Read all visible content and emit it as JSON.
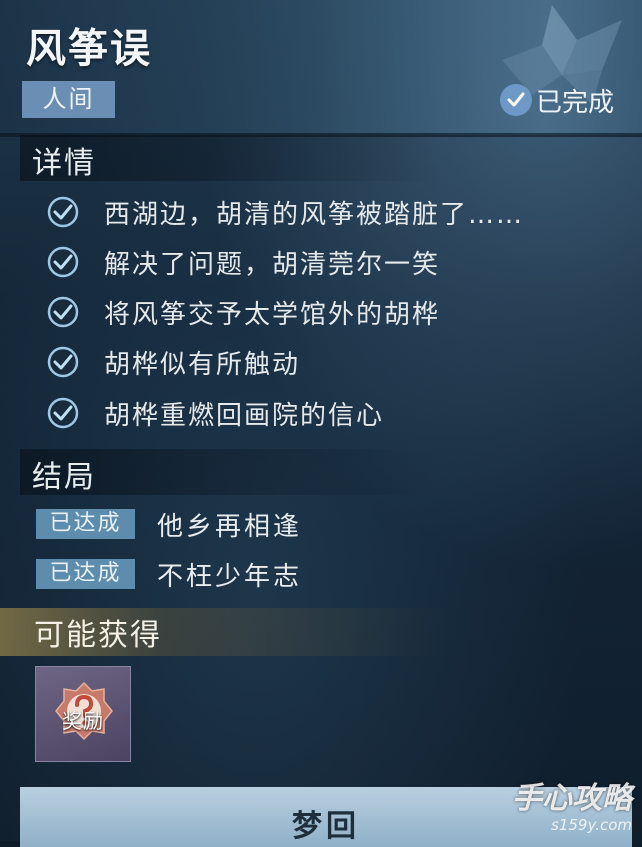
{
  "quest": {
    "title": "风筝误",
    "realm_tag": "人间",
    "status": "已完成"
  },
  "details": {
    "heading": "详情",
    "items": [
      {
        "text": "西湖边，胡清的风筝被踏脏了……",
        "done": true
      },
      {
        "text": "解决了问题，胡清莞尔一笑",
        "done": true
      },
      {
        "text": "将风筝交予太学馆外的胡桦",
        "done": true
      },
      {
        "text": "胡桦似有所触动",
        "done": true
      },
      {
        "text": "胡桦重燃回画院的信心",
        "done": true
      }
    ]
  },
  "endings": {
    "heading": "结局",
    "items": [
      {
        "badge": "已达成",
        "text": "他乡再相逢"
      },
      {
        "badge": "已达成",
        "text": "不枉少年志"
      }
    ]
  },
  "rewards": {
    "heading": "可能获得",
    "items": [
      {
        "label": "奖励",
        "icon": "question-mark-icon"
      }
    ]
  },
  "action": {
    "button_label": "梦回"
  },
  "watermark": {
    "main": "手心攻略",
    "sub": "s159y.com"
  },
  "colors": {
    "accent": "#6e99c7",
    "badge": "#5d8cad",
    "realm_tag": "#6b8eb4",
    "reward_band": "#bea050",
    "check": "#7fb0d8"
  }
}
